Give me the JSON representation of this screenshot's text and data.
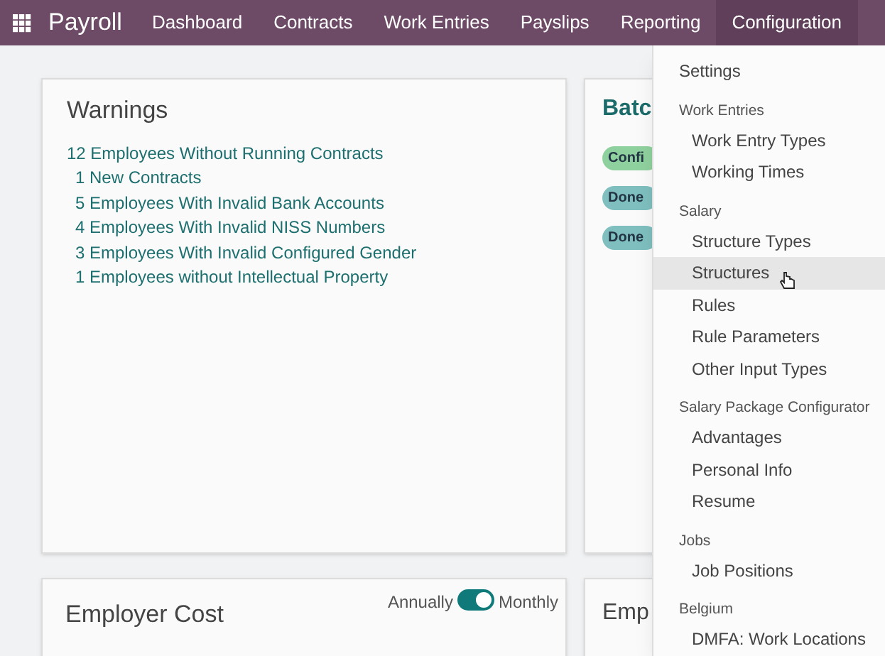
{
  "navbar": {
    "app": "Payroll",
    "menu": [
      {
        "label": "Dashboard",
        "selected": false
      },
      {
        "label": "Contracts",
        "selected": false
      },
      {
        "label": "Work Entries",
        "selected": false
      },
      {
        "label": "Payslips",
        "selected": false
      },
      {
        "label": "Reporting",
        "selected": false
      },
      {
        "label": "Configuration",
        "selected": true
      }
    ]
  },
  "warnings": {
    "title": "Warnings",
    "links": [
      {
        "label": "12 Employees Without Running Contracts",
        "kind": "main"
      },
      {
        "label": "1 New Contracts",
        "kind": "sub"
      },
      {
        "label": "5 Employees With Invalid Bank Accounts",
        "kind": "sub"
      },
      {
        "label": "4 Employees With Invalid NISS Numbers",
        "kind": "sub"
      },
      {
        "label": "3 Employees With Invalid Configured Gender",
        "kind": "sub"
      },
      {
        "label": "1 Employees without Intellectual Property",
        "kind": "sub"
      }
    ]
  },
  "batches": {
    "title": "Batc",
    "badges": [
      {
        "label": "Confi",
        "color": "#8fd19e"
      },
      {
        "label": "Done",
        "color": "#7fbfbf"
      },
      {
        "label": "Done",
        "color": "#7fbfbf"
      }
    ]
  },
  "employer_cost": {
    "title": "Employer Cost",
    "toggle": {
      "left": "Annually",
      "right": "Monthly",
      "on": true
    }
  },
  "card_4": {
    "title": "Emp"
  },
  "dropdown": {
    "sections": [
      {
        "items": [
          {
            "label": "Settings",
            "highlighted": false
          }
        ]
      },
      {
        "header": "Work Entries",
        "items": [
          {
            "label": "Work Entry Types",
            "highlighted": false
          },
          {
            "label": "Working Times",
            "highlighted": false
          }
        ]
      },
      {
        "header": "Salary",
        "items": [
          {
            "label": "Structure Types",
            "highlighted": false
          },
          {
            "label": "Structures",
            "highlighted": true
          },
          {
            "label": "Rules",
            "highlighted": false
          },
          {
            "label": "Rule Parameters",
            "highlighted": false
          },
          {
            "label": "Other Input Types",
            "highlighted": false
          }
        ]
      },
      {
        "header": "Salary Package Configurator",
        "items": [
          {
            "label": "Advantages",
            "highlighted": false
          },
          {
            "label": "Personal Info",
            "highlighted": false
          },
          {
            "label": "Resume",
            "highlighted": false
          }
        ]
      },
      {
        "header": "Jobs",
        "items": [
          {
            "label": "Job Positions",
            "highlighted": false
          }
        ]
      },
      {
        "header": "Belgium",
        "items": [
          {
            "label": "DMFA: Work Locations",
            "highlighted": false
          }
        ]
      }
    ]
  }
}
